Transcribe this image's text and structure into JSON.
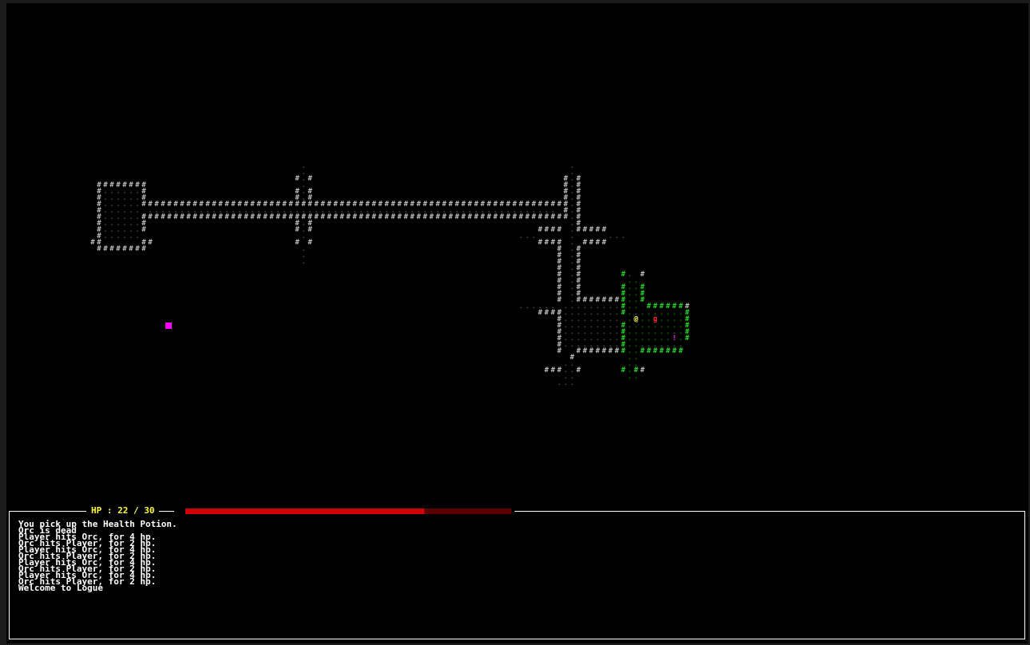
{
  "status": {
    "hp_label": "HP : 22 / 30",
    "hp_current": 22,
    "hp_max": 30
  },
  "log": [
    "You pick up the Health Potion.",
    "Orc is dead",
    "Player hits Orc, for 4 hp.",
    "Orc hits Player, for 2 hp.",
    "Player hits Orc, for 4 hp.",
    "Orc hits Player, for 2 hp.",
    "Player hits Orc, for 4 hp.",
    "Orc hits Player, for 2 hp.",
    "Player hits Orc, for 4 hp.",
    "Orc hits Player, for 2 hp.",
    "Welcome to Logue"
  ],
  "glyphs": {
    "player": "@",
    "orc": "g",
    "potion": "!",
    "wall": "#",
    "floor": "."
  },
  "colors": {
    "background": "#000000",
    "wall_explored": "#bdbdbd",
    "wall_visible": "#1fd61f",
    "player": "#ffff33",
    "enemy": "#ff2a2a",
    "item": "#ff33ff",
    "hp_bar": "#d40000"
  }
}
